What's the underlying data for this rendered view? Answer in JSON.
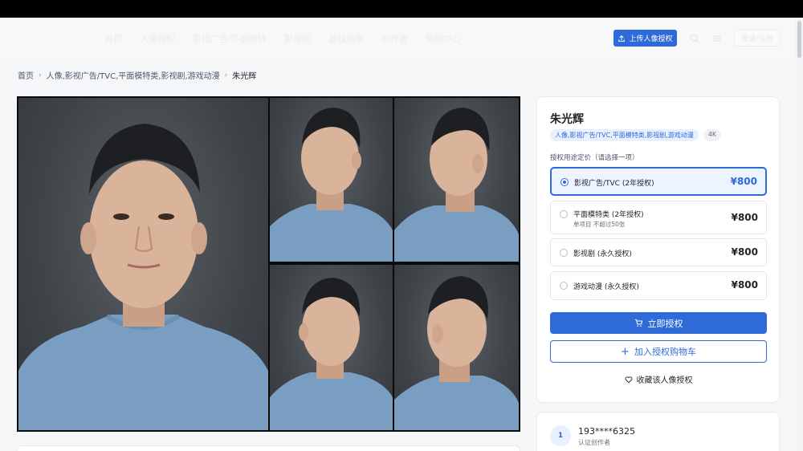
{
  "header": {
    "nav_items": [
      "首页",
      "人像授权",
      "影视广告/平面模特",
      "影视剧",
      "游戏动漫",
      "创作者",
      "帮助中心"
    ],
    "upload_label": "上传人像授权",
    "login_label": "登录/注册"
  },
  "breadcrumb": {
    "home": "首页",
    "category": "人像,影视广告/TVC,平面模特类,影视剧,游戏动漫",
    "current": "朱光辉"
  },
  "panel": {
    "title": "朱光辉",
    "tags": [
      "人像,影视广告/TVC,平面模特类,影视剧,游戏动漫",
      "4K"
    ],
    "subtitle": "授权用途定价（请选择一项）",
    "options": [
      {
        "label": "影视广告/TVC (2年授权)",
        "note": "",
        "price": "¥800",
        "selected": true
      },
      {
        "label": "平面模特类 (2年授权)",
        "note": "单项目 不超过50张",
        "price": "¥800",
        "selected": false
      },
      {
        "label": "影视剧 (永久授权)",
        "note": "",
        "price": "¥800",
        "selected": false
      },
      {
        "label": "游戏动漫 (永久授权)",
        "note": "",
        "price": "¥800",
        "selected": false
      }
    ],
    "buy_label": "立即授权",
    "cart_label": "加入授权购物车",
    "fav_label": "收藏该人像授权"
  },
  "creator": {
    "avatar_text": "1",
    "name": "193****6325",
    "role": "认证创作者"
  },
  "colors": {
    "accent": "#2f6ad9",
    "selected_bg": "#eef4ff",
    "shirt": "#7a9ec2",
    "skin": "#d9b39a"
  },
  "icons": {
    "upload": "upload-icon",
    "search": "search-icon",
    "menu": "menu-icon",
    "cart": "cart-icon",
    "plus": "plus-icon",
    "heart": "heart-icon"
  }
}
